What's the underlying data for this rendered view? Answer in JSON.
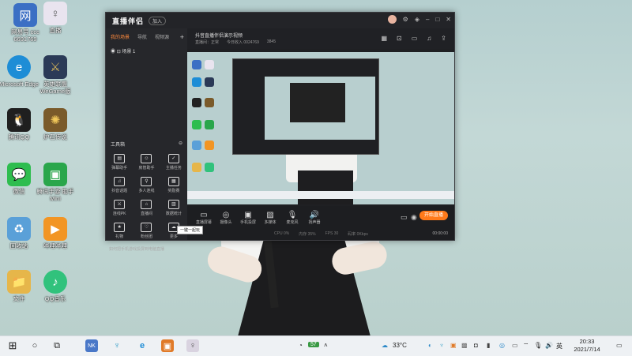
{
  "desktop": {
    "icons": [
      {
        "label": "网易号 ccc\n6691769",
        "name": "netease-icon",
        "color": "#3b6fc4",
        "glyph": "网"
      },
      {
        "label": "直播",
        "name": "anime-icon",
        "color": "#e9e4ef",
        "glyph": "♀"
      },
      {
        "label": "Microsoft Edge",
        "name": "edge-icon",
        "color": "#1e8dd6",
        "glyph": "e"
      },
      {
        "label": "英雄联盟 WeGame版",
        "name": "lol-icon",
        "color": "#2b3a57",
        "glyph": "⚔"
      },
      {
        "label": "腾讯QQ",
        "name": "qq-icon",
        "color": "#1f1f1f",
        "glyph": "🐧"
      },
      {
        "label": "炉石传说",
        "name": "hearthstone-icon",
        "color": "#7a5a2a",
        "glyph": "✺"
      },
      {
        "label": "微信",
        "name": "wechat-icon",
        "color": "#2ebd4f",
        "glyph": "💬"
      },
      {
        "label": "腾讯手游 助手Mini",
        "name": "tencent-games-icon",
        "color": "#2aa64b",
        "glyph": "▣"
      },
      {
        "label": "回收站",
        "name": "recycle-bin-icon",
        "color": "#5aa0d8",
        "glyph": "♻"
      },
      {
        "label": "哔哩哔哩",
        "name": "bilibili-icon",
        "color": "#f29524",
        "glyph": "▶"
      },
      {
        "label": "文件",
        "name": "folder-icon",
        "color": "#e6b64a",
        "glyph": "📁"
      },
      {
        "label": "QQ音乐",
        "name": "qqmusic-icon",
        "color": "#31c27c",
        "glyph": "♪"
      }
    ]
  },
  "app": {
    "brand": "直播伴侣",
    "badge": "加入",
    "tabs": [
      "我的场景",
      "导航",
      "视频源"
    ],
    "add_glyph": "+",
    "scene_item": "场景 1",
    "tools_title": "工具箱",
    "tools": [
      {
        "label": "弹幕助手",
        "glyph": "▤"
      },
      {
        "label": "房管助手",
        "glyph": "☺"
      },
      {
        "label": "主播任务",
        "glyph": "✓"
      },
      {
        "label": "抖音话题",
        "glyph": "♫"
      },
      {
        "label": "多人连线",
        "glyph": "⚲"
      },
      {
        "label": "奖励赛",
        "glyph": "▦"
      },
      {
        "label": "连线PK",
        "glyph": "⚔"
      },
      {
        "label": "直播间",
        "glyph": "⌂"
      },
      {
        "label": "数据统计",
        "glyph": "▥"
      },
      {
        "label": "礼物",
        "glyph": "★"
      },
      {
        "label": "粉丝团",
        "glyph": "♡"
      },
      {
        "label": "更多",
        "glyph": "☁"
      }
    ],
    "tip": "如何把手机游戏投屏到电脑直播",
    "stream_title": "抖音直播伴侣演示视频",
    "stream_meta": [
      "直播间：正常",
      "今日收入 0024769",
      "3845"
    ],
    "controls": [
      {
        "label": "直播屏幕",
        "glyph": "▭"
      },
      {
        "label": "摄像头",
        "glyph": "◎"
      },
      {
        "label": "手机投屏",
        "glyph": "▣"
      },
      {
        "label": "多媒体",
        "glyph": "▨"
      },
      {
        "label": "麦克风",
        "glyph": "🎙"
      },
      {
        "label": "扬声器",
        "glyph": "🔊"
      }
    ],
    "go_live": "开始直播",
    "status_items": [
      "CPU 0%",
      "内存 35%",
      "FPS 30",
      "码率 0Kbps"
    ],
    "timer": "00:00:00",
    "cursor_tooltip": "一键一起玩"
  },
  "taskbar": {
    "start_glyph": "⊞",
    "search_glyph": "○",
    "taskview_glyph": "⧉",
    "apps": [
      {
        "name": "nk-app-icon",
        "glyph": "NK",
        "color": "#4a78c8"
      },
      {
        "name": "tiktok-app-icon",
        "glyph": "♆",
        "color": "#3aa0c8"
      },
      {
        "name": "edge-taskbar-icon",
        "glyph": "e",
        "color": "#1e8dd6"
      },
      {
        "name": "game-taskbar-icon",
        "glyph": "▣",
        "color": "#e07a28"
      },
      {
        "name": "live-companion-taskbar-icon",
        "glyph": "♀",
        "color": "#d9d3e0"
      }
    ],
    "battery_label": "57",
    "weather": "33°C",
    "lang": "英",
    "time": "20:33",
    "date": "2021/7/14"
  }
}
